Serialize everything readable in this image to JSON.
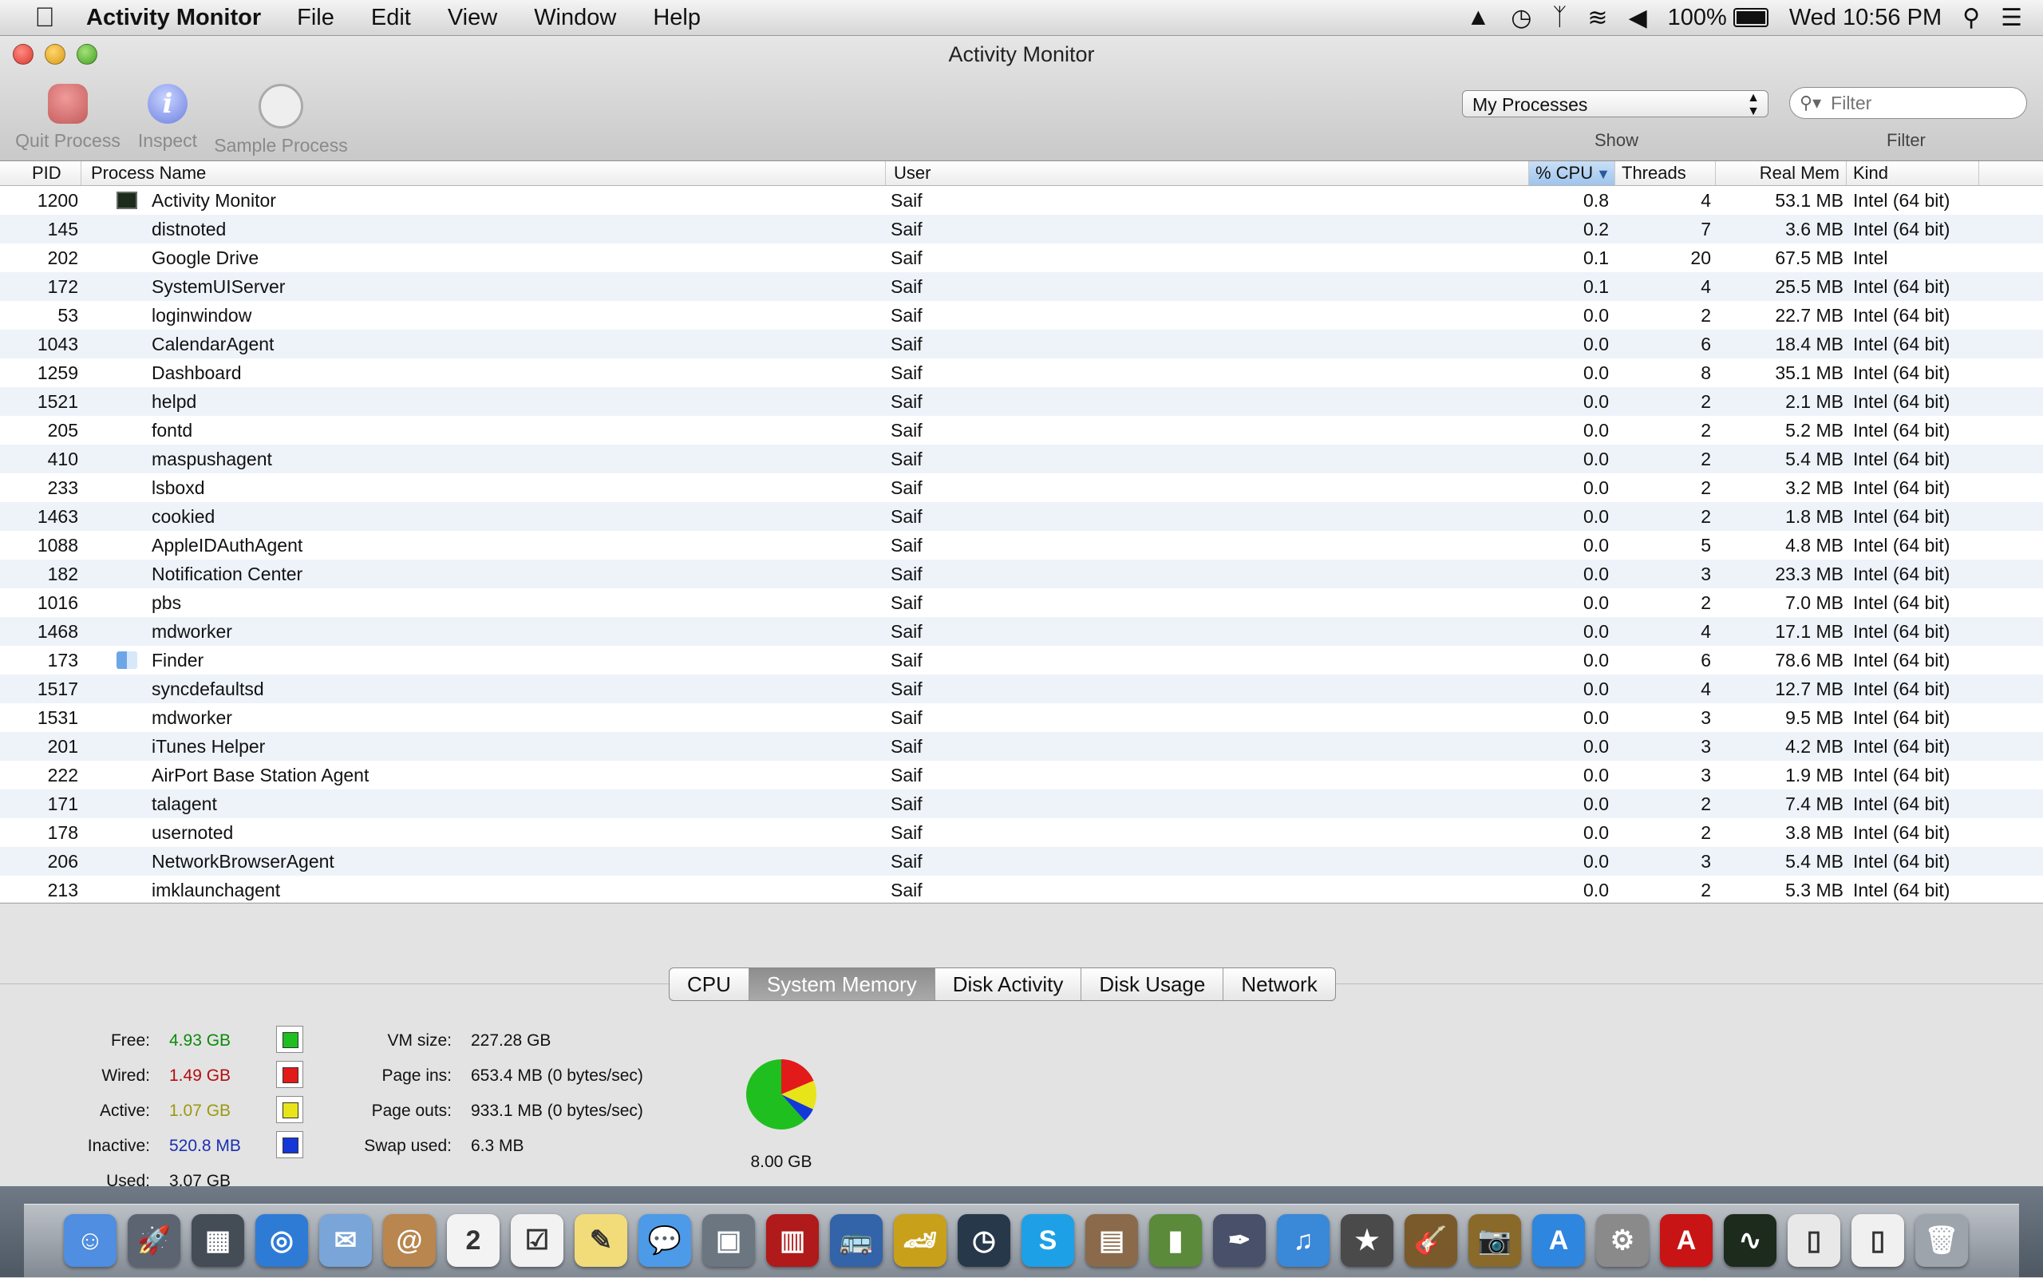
{
  "menubar": {
    "app_name": "Activity Monitor",
    "menus": [
      "File",
      "Edit",
      "View",
      "Window",
      "Help"
    ],
    "battery_text": "100%",
    "clock": "Wed 10:56 PM"
  },
  "window": {
    "title": "Activity Monitor",
    "toolbar": {
      "quit_label": "Quit Process",
      "inspect_label": "Inspect",
      "sample_label": "Sample Process",
      "show_label": "Show",
      "show_value": "My Processes",
      "filter_label": "Filter",
      "filter_placeholder": "Filter"
    }
  },
  "table": {
    "columns": {
      "pid": "PID",
      "name": "Process Name",
      "user": "User",
      "cpu": "% CPU",
      "threads": "Threads",
      "mem": "Real Mem",
      "kind": "Kind"
    },
    "rows": [
      {
        "pid": "1200",
        "icon": "activity-monitor",
        "name": "Activity Monitor",
        "user": "Saif",
        "cpu": "0.8",
        "threads": "4",
        "mem": "53.1 MB",
        "kind": "Intel (64 bit)"
      },
      {
        "pid": "145",
        "icon": "",
        "name": "distnoted",
        "user": "Saif",
        "cpu": "0.2",
        "threads": "7",
        "mem": "3.6 MB",
        "kind": "Intel (64 bit)"
      },
      {
        "pid": "202",
        "icon": "",
        "name": "Google Drive",
        "user": "Saif",
        "cpu": "0.1",
        "threads": "20",
        "mem": "67.5 MB",
        "kind": "Intel"
      },
      {
        "pid": "172",
        "icon": "",
        "name": "SystemUIServer",
        "user": "Saif",
        "cpu": "0.1",
        "threads": "4",
        "mem": "25.5 MB",
        "kind": "Intel (64 bit)"
      },
      {
        "pid": "53",
        "icon": "",
        "name": "loginwindow",
        "user": "Saif",
        "cpu": "0.0",
        "threads": "2",
        "mem": "22.7 MB",
        "kind": "Intel (64 bit)"
      },
      {
        "pid": "1043",
        "icon": "",
        "name": "CalendarAgent",
        "user": "Saif",
        "cpu": "0.0",
        "threads": "6",
        "mem": "18.4 MB",
        "kind": "Intel (64 bit)"
      },
      {
        "pid": "1259",
        "icon": "",
        "name": "Dashboard",
        "user": "Saif",
        "cpu": "0.0",
        "threads": "8",
        "mem": "35.1 MB",
        "kind": "Intel (64 bit)"
      },
      {
        "pid": "1521",
        "icon": "",
        "name": "helpd",
        "user": "Saif",
        "cpu": "0.0",
        "threads": "2",
        "mem": "2.1 MB",
        "kind": "Intel (64 bit)"
      },
      {
        "pid": "205",
        "icon": "",
        "name": "fontd",
        "user": "Saif",
        "cpu": "0.0",
        "threads": "2",
        "mem": "5.2 MB",
        "kind": "Intel (64 bit)"
      },
      {
        "pid": "410",
        "icon": "",
        "name": "maspushagent",
        "user": "Saif",
        "cpu": "0.0",
        "threads": "2",
        "mem": "5.4 MB",
        "kind": "Intel (64 bit)"
      },
      {
        "pid": "233",
        "icon": "",
        "name": "lsboxd",
        "user": "Saif",
        "cpu": "0.0",
        "threads": "2",
        "mem": "3.2 MB",
        "kind": "Intel (64 bit)"
      },
      {
        "pid": "1463",
        "icon": "",
        "name": "cookied",
        "user": "Saif",
        "cpu": "0.0",
        "threads": "2",
        "mem": "1.8 MB",
        "kind": "Intel (64 bit)"
      },
      {
        "pid": "1088",
        "icon": "",
        "name": "AppleIDAuthAgent",
        "user": "Saif",
        "cpu": "0.0",
        "threads": "5",
        "mem": "4.8 MB",
        "kind": "Intel (64 bit)"
      },
      {
        "pid": "182",
        "icon": "",
        "name": "Notification Center",
        "user": "Saif",
        "cpu": "0.0",
        "threads": "3",
        "mem": "23.3 MB",
        "kind": "Intel (64 bit)"
      },
      {
        "pid": "1016",
        "icon": "",
        "name": "pbs",
        "user": "Saif",
        "cpu": "0.0",
        "threads": "2",
        "mem": "7.0 MB",
        "kind": "Intel (64 bit)"
      },
      {
        "pid": "1468",
        "icon": "",
        "name": "mdworker",
        "user": "Saif",
        "cpu": "0.0",
        "threads": "4",
        "mem": "17.1 MB",
        "kind": "Intel (64 bit)"
      },
      {
        "pid": "173",
        "icon": "finder",
        "name": "Finder",
        "user": "Saif",
        "cpu": "0.0",
        "threads": "6",
        "mem": "78.6 MB",
        "kind": "Intel (64 bit)"
      },
      {
        "pid": "1517",
        "icon": "",
        "name": "syncdefaultsd",
        "user": "Saif",
        "cpu": "0.0",
        "threads": "4",
        "mem": "12.7 MB",
        "kind": "Intel (64 bit)"
      },
      {
        "pid": "1531",
        "icon": "",
        "name": "mdworker",
        "user": "Saif",
        "cpu": "0.0",
        "threads": "3",
        "mem": "9.5 MB",
        "kind": "Intel (64 bit)"
      },
      {
        "pid": "201",
        "icon": "",
        "name": "iTunes Helper",
        "user": "Saif",
        "cpu": "0.0",
        "threads": "3",
        "mem": "4.2 MB",
        "kind": "Intel (64 bit)"
      },
      {
        "pid": "222",
        "icon": "",
        "name": "AirPort Base Station Agent",
        "user": "Saif",
        "cpu": "0.0",
        "threads": "3",
        "mem": "1.9 MB",
        "kind": "Intel (64 bit)"
      },
      {
        "pid": "171",
        "icon": "",
        "name": "talagent",
        "user": "Saif",
        "cpu": "0.0",
        "threads": "2",
        "mem": "7.4 MB",
        "kind": "Intel (64 bit)"
      },
      {
        "pid": "178",
        "icon": "",
        "name": "usernoted",
        "user": "Saif",
        "cpu": "0.0",
        "threads": "2",
        "mem": "3.8 MB",
        "kind": "Intel (64 bit)"
      },
      {
        "pid": "206",
        "icon": "",
        "name": "NetworkBrowserAgent",
        "user": "Saif",
        "cpu": "0.0",
        "threads": "3",
        "mem": "5.4 MB",
        "kind": "Intel (64 bit)"
      },
      {
        "pid": "213",
        "icon": "",
        "name": "imklaunchagent",
        "user": "Saif",
        "cpu": "0.0",
        "threads": "2",
        "mem": "5.3 MB",
        "kind": "Intel (64 bit)"
      }
    ]
  },
  "panel": {
    "tabs": [
      "CPU",
      "System Memory",
      "Disk Activity",
      "Disk Usage",
      "Network"
    ],
    "active_tab": "System Memory",
    "memory": {
      "free_label": "Free:",
      "free": "4.93 GB",
      "wired_label": "Wired:",
      "wired": "1.49 GB",
      "active_label": "Active:",
      "active": "1.07 GB",
      "inactive_label": "Inactive:",
      "inactive": "520.8 MB",
      "used_label": "Used:",
      "used": "3.07 GB"
    },
    "vm": {
      "vmsize_label": "VM size:",
      "vmsize": "227.28 GB",
      "pageins_label": "Page ins:",
      "pageins": "653.4 MB (0 bytes/sec)",
      "pageouts_label": "Page outs:",
      "pageouts": "933.1 MB (0 bytes/sec)",
      "swap_label": "Swap used:",
      "swap": "6.3 MB"
    },
    "pie_total": "8.00 GB",
    "pie_gb": {
      "free": 4.93,
      "wired": 1.49,
      "active": 1.07,
      "inactive": 0.5086
    },
    "colors": {
      "free": "#1fbf1f",
      "wired": "#e21a1a",
      "active": "#e8e41a",
      "inactive": "#1438d8",
      "free_text": "#0c8a0c",
      "wired_text": "#b30d0d",
      "active_text": "#9a9a10",
      "inactive_text": "#1a2fb0"
    }
  },
  "dock": {
    "items": [
      {
        "name": "finder-icon",
        "color": "#4f8ee0",
        "glyph": "☺"
      },
      {
        "name": "launchpad-icon",
        "color": "#5b6470",
        "glyph": "🚀"
      },
      {
        "name": "mission-control-icon",
        "color": "#444c56",
        "glyph": "▦"
      },
      {
        "name": "safari-icon",
        "color": "#2e7bd6",
        "glyph": "◎"
      },
      {
        "name": "mail-icon",
        "color": "#7aa5d8",
        "glyph": "✉"
      },
      {
        "name": "contacts-icon",
        "color": "#b8864e",
        "glyph": "@"
      },
      {
        "name": "calendar-icon",
        "color": "#f3f3f3",
        "glyph": "2"
      },
      {
        "name": "reminders-icon",
        "color": "#f2f2f2",
        "glyph": "☑"
      },
      {
        "name": "notes-icon",
        "color": "#f2dc7a",
        "glyph": "✎"
      },
      {
        "name": "messages-icon",
        "color": "#4d9ae8",
        "glyph": "💬"
      },
      {
        "name": "facetime-icon",
        "color": "#6b7680",
        "glyph": "▣"
      },
      {
        "name": "photo-booth-icon",
        "color": "#b01a1a",
        "glyph": "▥"
      },
      {
        "name": "bus-driver-icon",
        "color": "#3363a8",
        "glyph": "🚌"
      },
      {
        "name": "racing-game-icon",
        "color": "#c8a01a",
        "glyph": "🏎"
      },
      {
        "name": "dashboard-icon",
        "color": "#27384a",
        "glyph": "◷"
      },
      {
        "name": "skype-icon",
        "color": "#1ea0e6",
        "glyph": "S"
      },
      {
        "name": "keynote-icon",
        "color": "#8a6a4a",
        "glyph": "▤"
      },
      {
        "name": "numbers-icon",
        "color": "#5a8a3a",
        "glyph": "▮"
      },
      {
        "name": "iphoto-icon",
        "color": "#48506a",
        "glyph": "✒"
      },
      {
        "name": "itunes-icon",
        "color": "#3a88d8",
        "glyph": "♫"
      },
      {
        "name": "imovie-icon",
        "color": "#4a4a4a",
        "glyph": "★"
      },
      {
        "name": "garageband-icon",
        "color": "#7a5a2a",
        "glyph": "🎸"
      },
      {
        "name": "aperture-icon",
        "color": "#8a6a2a",
        "glyph": "📷"
      },
      {
        "name": "app-store-icon",
        "color": "#2e86de",
        "glyph": "A"
      },
      {
        "name": "system-preferences-icon",
        "color": "#8a8a8a",
        "glyph": "⚙"
      },
      {
        "name": "acrobat-icon",
        "color": "#c81414",
        "glyph": "A"
      },
      {
        "name": "activity-monitor-icon",
        "color": "#1c2b1c",
        "glyph": "∿"
      },
      {
        "name": "preview-document-icon",
        "color": "#e8e8e8",
        "glyph": "▯"
      },
      {
        "name": "document-icon",
        "color": "#f0f0f0",
        "glyph": "▯"
      },
      {
        "name": "trash-icon",
        "color": "#9ea4ab",
        "glyph": "🗑"
      }
    ]
  }
}
